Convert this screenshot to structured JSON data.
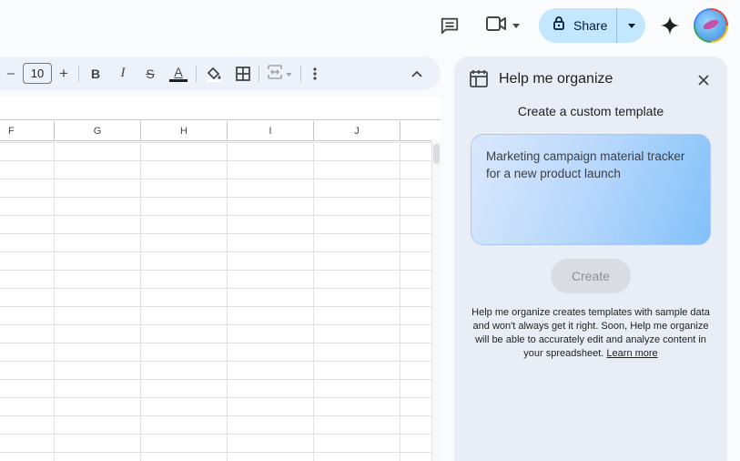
{
  "header": {
    "share_label": "Share",
    "icons": [
      "comment-icon",
      "video-call-icon",
      "lock-icon",
      "chevron-down-icon",
      "sparkle-icon",
      "avatar"
    ]
  },
  "toolbar": {
    "font_size": "10",
    "decrease_label": "–",
    "increase_label": "+",
    "bold_label": "B",
    "italic_label": "I",
    "strike_label": "S",
    "text_color_label": "A"
  },
  "sheet": {
    "columns": [
      "F",
      "G",
      "H",
      "I",
      "J"
    ]
  },
  "panel": {
    "title": "Help me organize",
    "subtitle": "Create a custom template",
    "prompt_text": "Marketing campaign material tracker for a new product launch",
    "create_label": "Create",
    "disclaimer": "Help me organize creates templates with sample data and won't always get it right. Soon, Help me organize will be able to accurately edit and analyze content in your spreadsheet.",
    "learn_more": "Learn more"
  },
  "colors": {
    "share_bg": "#c2e7ff",
    "panel_bg": "#e9eef6",
    "toolbar_bg": "#edf2fa",
    "prompt_gradient_end": "#82c1fa"
  }
}
